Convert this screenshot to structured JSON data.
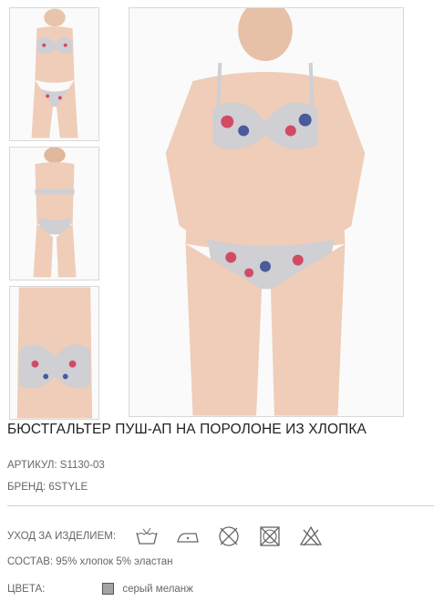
{
  "gallery": {
    "thumbnails": [
      {
        "alt": "front view"
      },
      {
        "alt": "back view"
      },
      {
        "alt": "close-up"
      }
    ]
  },
  "product": {
    "title": "БЮСТГАЛЬТЕР ПУШ-АП НА ПОРОЛОНЕ ИЗ ХЛОПКА",
    "article": "АРТИКУЛ: S1130-03",
    "brand": "БРЕНД: 6STYLE",
    "care_label": "УХОД ЗА ИЗДЕЛИЕМ:",
    "care_icons": [
      "hand-wash-icon",
      "iron-low-icon",
      "no-dry-clean-icon",
      "no-tumble-dry-icon",
      "no-bleach-icon"
    ],
    "composition": "СОСТАВ: 95% хлопок 5% эластан",
    "colors_label": "ЦВЕТА:",
    "color_name": "серый меланж",
    "color_hex": "#a7a2a2"
  }
}
